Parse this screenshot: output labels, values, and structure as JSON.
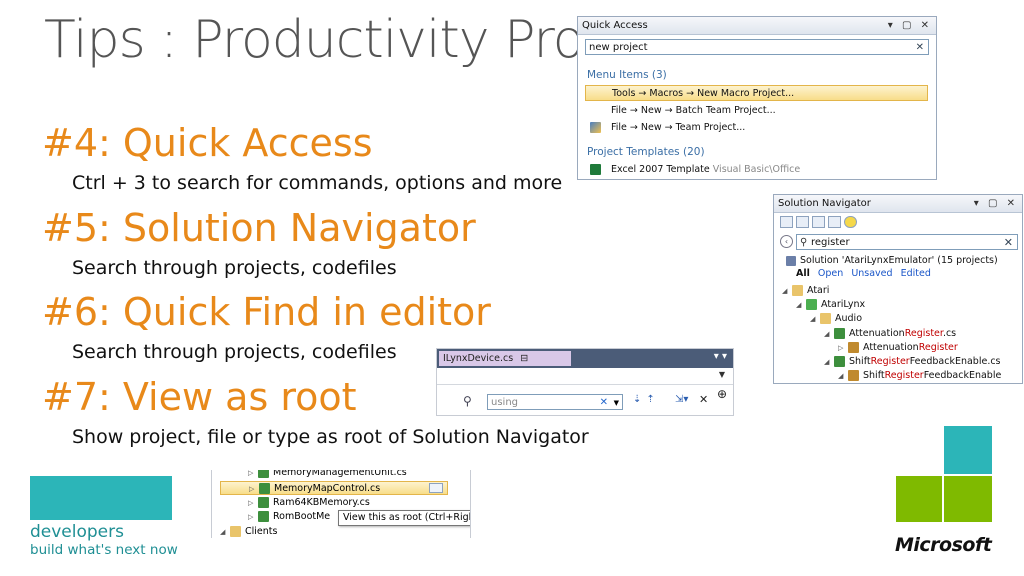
{
  "slide": {
    "title": "Tips : Productivity Pro",
    "tips": [
      {
        "heading": "#4: Quick Access",
        "desc": "Ctrl + 3 to search for commands, options and more"
      },
      {
        "heading": "#5: Solution Navigator",
        "desc": "Search through projects, codefiles"
      },
      {
        "heading": "#6: Quick Find in editor",
        "desc": "Search through projects, codefiles"
      },
      {
        "heading": "#7: View as root",
        "desc": "Show project, file or type as root of Solution Navigator"
      }
    ]
  },
  "quick_access": {
    "title": "Quick Access",
    "window_buttons": "▾ ▢ ✕",
    "search_value": "new project",
    "clear": "✕",
    "menu_section": "Menu Items (3)",
    "menu_items": [
      "Tools → Macros → New Macro Project...",
      "File → New → Batch Team Project...",
      "File → New → Team Project..."
    ],
    "templates_section": "Project Templates (20)",
    "template_name": "Excel 2007 Template",
    "template_detail": "Visual Basic\\Office"
  },
  "solution_navigator": {
    "title": "Solution Navigator",
    "window_buttons": "▾ ▢ ✕",
    "search_value": "register",
    "clear": "✕",
    "solution": "Solution 'AtariLynxEmulator' (15 projects)",
    "filters": [
      "All",
      "Open",
      "Unsaved",
      "Edited"
    ],
    "tree": {
      "atari": "Atari",
      "atarilynx": "AtariLynx",
      "audio": "Audio",
      "file1_pre": "Attenuation",
      "file1_match": "Register",
      "file1_post": ".cs",
      "class1_pre": "Attenuation",
      "class1_match": "Register",
      "file2_pre": "Shift",
      "file2_match": "Register",
      "file2_post": "FeedbackEnable.cs",
      "class2_pre": "Shift",
      "class2_match": "Register",
      "class2_post": "FeedbackEnable"
    }
  },
  "editor": {
    "tab_label": "ILynxDevice.cs",
    "find_value": "using",
    "overflow": "▾ ▾",
    "clear": "✕",
    "close": "✕"
  },
  "file_list": {
    "items": [
      "MemoryManagementUnit.cs",
      "MemoryMapControl.cs",
      "Ram64KBMemory.cs",
      "RomBootMe",
      "Clients"
    ],
    "tooltip": "View this as root (Ctrl+Right)"
  },
  "branding": {
    "developers": "developers",
    "tagline": "build what's next now",
    "microsoft": "Microsoft",
    "teal": "#2cb5b8",
    "green": "#7fba00",
    "orange": "#E8891A"
  }
}
